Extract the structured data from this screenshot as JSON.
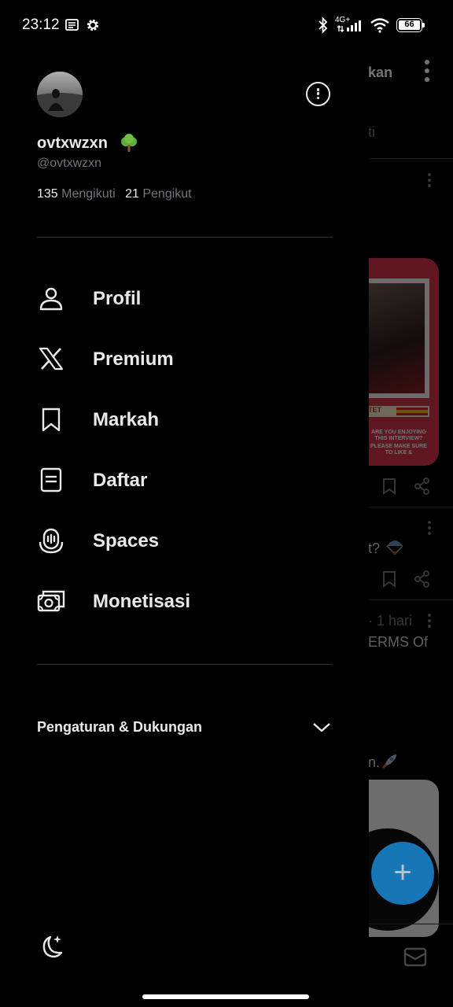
{
  "status_bar": {
    "time": "23:12",
    "network": "4G+",
    "battery": "66",
    "icons": [
      "notification-list-icon",
      "settings-gear-icon",
      "bluetooth-icon",
      "signal-icon",
      "wifi-icon",
      "battery-icon"
    ]
  },
  "profile": {
    "name": "ovtxwzxn",
    "name_emoji": "tree-emoji",
    "handle": "@ovtxwzxn",
    "following_count": "135",
    "following_label": "Mengikuti",
    "followers_count": "21",
    "followers_label": "Pengikut"
  },
  "menu": [
    {
      "label": "Profil",
      "icon": "person-icon"
    },
    {
      "label": "Premium",
      "icon": "x-logo-icon"
    },
    {
      "label": "Markah",
      "icon": "bookmark-icon"
    },
    {
      "label": "Daftar",
      "icon": "list-icon"
    },
    {
      "label": "Spaces",
      "icon": "spaces-microphone-icon"
    },
    {
      "label": "Monetisasi",
      "icon": "money-icon"
    }
  ],
  "settings": {
    "label": "Pengaturan & Dukungan",
    "expanded": false
  },
  "background_timeline": {
    "header_fragment": "kan",
    "tab_fragment": "ti",
    "post_fragment_1": "t?",
    "post_fragment_2_meta": "· 1 hari",
    "post_fragment_2_text": "ERMS Of",
    "post_fragment_3": "n.",
    "media_caption_1": "ARE YOU ENJOYING THIS INTERVIEW?",
    "media_caption_2": "PLEASE MAKE SURE TO LIKE & SUBSCRIBE!",
    "media_badge": "TET"
  },
  "colors": {
    "background": "#000000",
    "text_primary": "#e7e9ea",
    "text_secondary": "#71767b",
    "divider": "#2f3336",
    "fab": "#1d9bf0"
  }
}
